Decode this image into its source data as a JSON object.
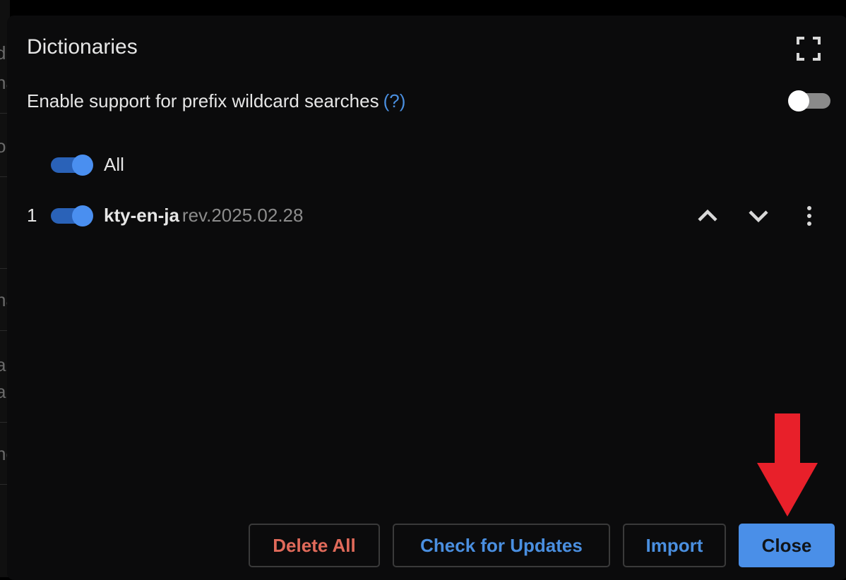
{
  "dialog": {
    "title": "Dictionaries"
  },
  "options": {
    "prefix_wildcard_label": "Enable support for prefix wildcard searches",
    "help_link": "(?)",
    "prefix_wildcard_enabled": false
  },
  "dictionaries": {
    "all_label": "All",
    "all_enabled": true,
    "items": [
      {
        "index": "1",
        "name": "kty-en-ja",
        "revision": "rev.2025.02.28",
        "enabled": true
      }
    ]
  },
  "actions": {
    "delete_all": "Delete All",
    "check_updates": "Check for Updates",
    "import": "Import",
    "close": "Close"
  },
  "icons": {
    "fullscreen": "fullscreen-icon",
    "move_up": "chevron-up-icon",
    "move_down": "chevron-down-icon",
    "more": "more-vertical-icon",
    "annotation": "arrow-down-annotation"
  },
  "colors": {
    "accent": "#4a8fe8",
    "danger": "#e06a5a",
    "annotation": "#e8202a"
  }
}
